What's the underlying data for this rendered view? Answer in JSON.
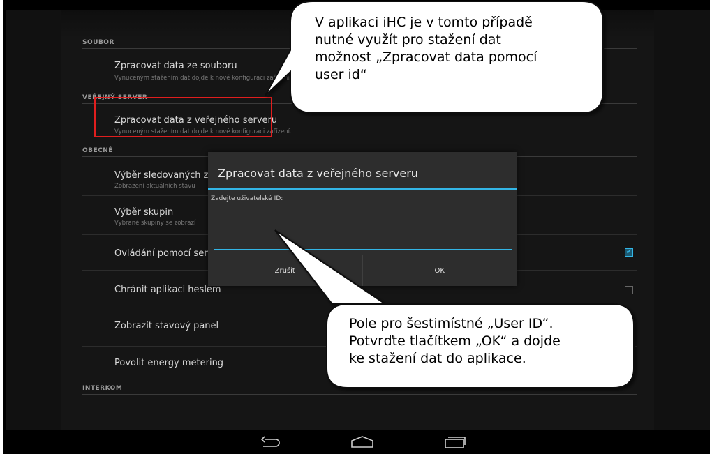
{
  "sections": {
    "soubor": "SOUBOR",
    "verejny_server": "VEŘEJNÝ SERVER",
    "obecne": "OBECNÉ",
    "interkom": "INTERKOM"
  },
  "items": {
    "file": {
      "title": "Zpracovat data ze souboru",
      "subtitle": "Vynuceným stažením dat dojde k nové konfiguraci zařízení."
    },
    "server": {
      "title": "Zpracovat data z veřejného serveru",
      "subtitle": "Vynuceným stažením dat dojde k nové konfiguraci zařízení."
    },
    "zones": {
      "title": "Výběr sledovaných zón",
      "subtitle": "Zobrazení aktuálních stavu"
    },
    "groups": {
      "title": "Výběr skupin",
      "subtitle": "Vybrané skupiny se zobrazí"
    },
    "sensor": {
      "title": "Ovládání pomocí senzoru"
    },
    "password": {
      "title": "Chránit aplikaci heslem"
    },
    "statusbar": {
      "title": "Zobrazit stavový panel"
    },
    "energy": {
      "title": "Povolit energy metering"
    }
  },
  "checkbox_states": {
    "sensor": true,
    "password": false
  },
  "dialog": {
    "title": "Zpracovat data z veřejného serveru",
    "label": "Zadejte uživatelské ID:",
    "input_value": "",
    "cancel": "Zrušit",
    "ok": "OK"
  },
  "callouts": {
    "top": [
      "V aplikaci iHC je v tomto případě",
      "nutné využít pro stažení dat",
      "možnost „Zpracovat data pomocí",
      "user id“"
    ],
    "bottom": [
      "Pole pro šestimístné „User ID“.",
      "Potvrďte tlačítkem „OK“ a dojde",
      "ke stažení dat do aplikace."
    ]
  },
  "colors": {
    "accent": "#33b5e5",
    "highlight": "#e01e1e"
  },
  "nav_icons": [
    "back-icon",
    "home-icon",
    "recent-apps-icon"
  ]
}
